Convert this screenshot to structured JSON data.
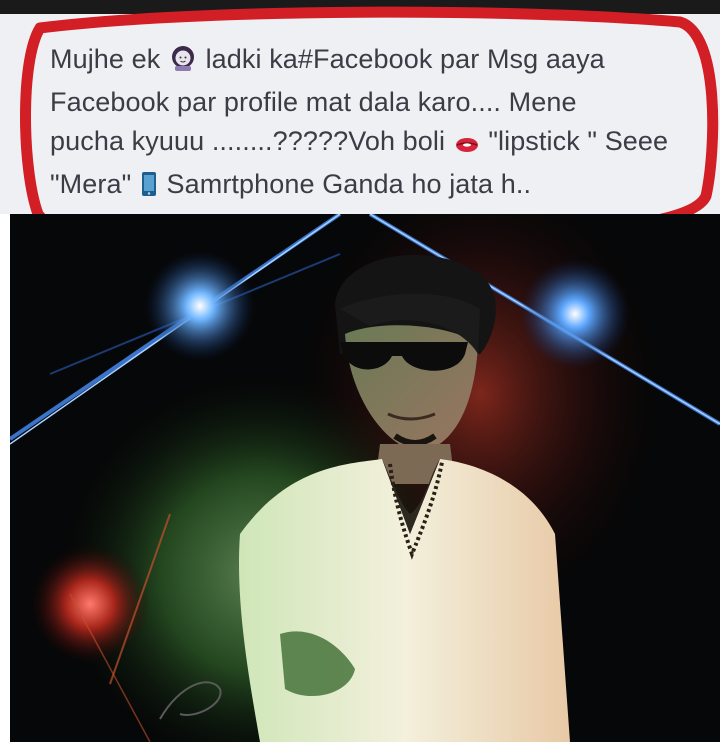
{
  "caption": {
    "line1_a": "Mujhe ek",
    "line1_b": "ladki ka#Facebook par Msg aaya",
    "line2": "Facebook par profile mat dala karo.... Mene",
    "line3_a": "pucha kyuuu ........?????Voh boli",
    "line3_b": "\"lipstick \" Seee",
    "line4_a": "\"Mera\"",
    "line4_b": "Samrtphone Ganda ho jata h.."
  },
  "icons": {
    "girl": "girl-emoji-icon",
    "lips": "lips-emoji-icon",
    "phone": "phone-emoji-icon"
  },
  "colors": {
    "highlight_circle": "#d21f26",
    "text": "#3a3d45",
    "post_background": "#eef0f3"
  }
}
